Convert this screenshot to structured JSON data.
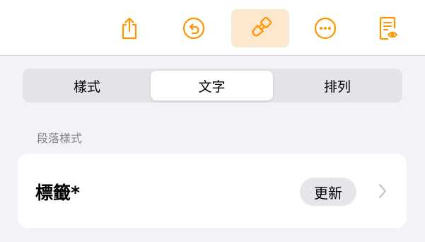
{
  "toolbar": {
    "accent_color": "#ff9500",
    "active_bg": "#fde7cf",
    "buttons": [
      {
        "icon": "share-icon",
        "active": false
      },
      {
        "icon": "undo-icon",
        "active": false
      },
      {
        "icon": "paintbrush-icon",
        "active": true
      },
      {
        "icon": "more-icon",
        "active": false
      },
      {
        "icon": "reader-view-icon",
        "active": false
      }
    ]
  },
  "segmented": {
    "tabs": [
      "樣式",
      "文字",
      "排列"
    ],
    "selected": "文字"
  },
  "paragraph_style": {
    "section_label": "段落樣式",
    "style_name": "標籤*",
    "update_label": "更新"
  }
}
